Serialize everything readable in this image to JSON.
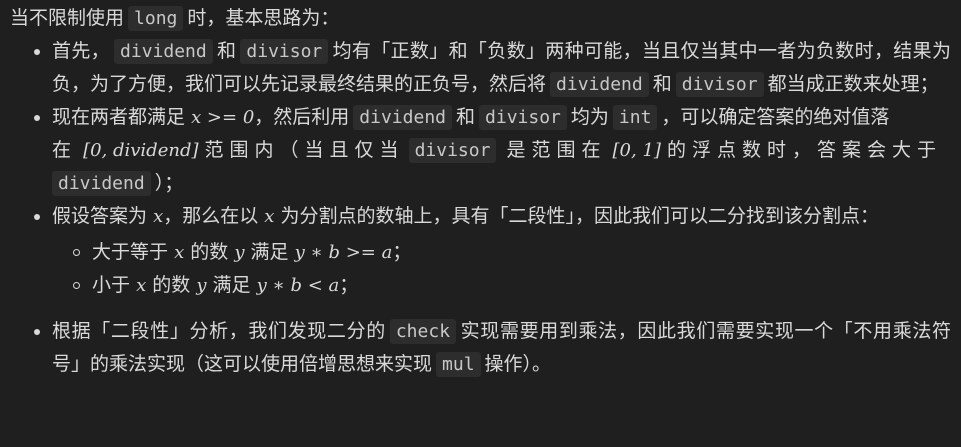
{
  "intro": {
    "t1": "当不限制使用",
    "code": "long",
    "t2": "时，基本思路为："
  },
  "item1": {
    "t1": "首先，",
    "c1": "dividend",
    "t2": "和",
    "c2": "divisor",
    "t3": "均有「正数」和「负数」两种可能，当且仅当其中一者为负数时，结果为负，为了方便，我们可以先记录最终结果的正负号，然后将",
    "c3": "dividend",
    "t4": "和",
    "c4": "divisor",
    "t5": "都当成正数来处理；"
  },
  "item2": {
    "t1": "现在两者都满足",
    "m1": "x >= 0",
    "t2": "，然后利用",
    "c1": "dividend",
    "t3": "和",
    "c2": "divisor",
    "t4": "均为",
    "c3": "int",
    "t5": "，可以确定答案的绝对值落",
    "t6": "在",
    "m2": "[0, dividend]",
    "t7": "范围内（当且仅当",
    "c4": "divisor",
    "t8": "是范围在",
    "m3": "[0, 1]",
    "t9": "的浮点数时，答案会大于",
    "c5": "dividend",
    "t10": "）；"
  },
  "item3": {
    "t1": "假设答案为",
    "m1": "x",
    "t2": "，那么在以",
    "m2": "x",
    "t3": "为分割点的数轴上，具有「二段性」，因此我们可以二分找到该分割点：",
    "sub1": {
      "t1": "大于等于",
      "m1": "x",
      "t2": "的数",
      "m2": "y",
      "t3": "满足",
      "m3": "y ∗ b >= a",
      "t4": "；"
    },
    "sub2": {
      "t1": "小于",
      "m1": "x",
      "t2": "的数",
      "m2": "y",
      "t3": "满足",
      "m3": "y ∗ b < a",
      "t4": "；"
    }
  },
  "item4": {
    "t1": "根据「二段性」分析，我们发现二分的",
    "c1": "check",
    "t2": "实现需要用到乘法，因此我们需要实现一个「不用乘法符号」的乘法实现（这可以使用倍增思想来实现",
    "c2": "mul",
    "t3": "操作）。"
  }
}
